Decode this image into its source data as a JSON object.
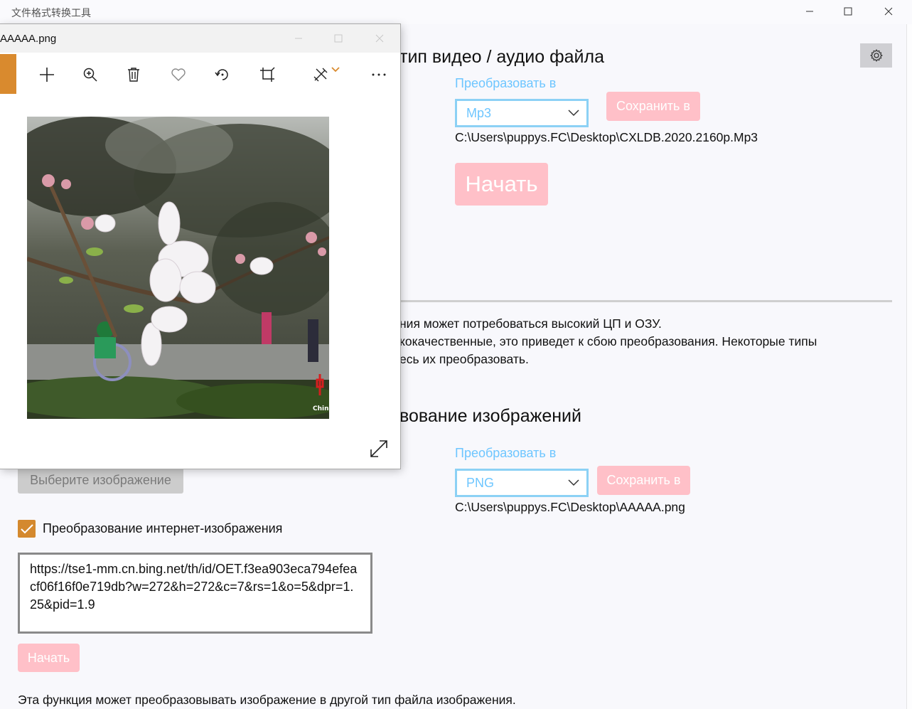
{
  "app": {
    "title": "文件格式转换工具"
  },
  "window_controls": {
    "minimize": "—",
    "maximize": "□",
    "close": "✕"
  },
  "video_section": {
    "title": "тип видео / аудио файла",
    "convert_to_label": "Преобразовать в",
    "format_value": "Mp3",
    "save_button": "Сохранить в",
    "output_path": "C:\\Users\\puppys.FC\\Desktop\\CXLDB.2020.2160p.Mp3",
    "start_button": "Начать"
  },
  "notes": {
    "line1": "ния может потребоваться высокий ЦП и ОЗУ.",
    "line2": "кокачественные, это приведет к сбою преобразования. Некоторые типы",
    "line3": "есь их преобразовать."
  },
  "image_section": {
    "title": "вование изображений",
    "convert_to_label": "Преобразовать в",
    "format_value": "PNG",
    "save_button": "Сохранить в",
    "output_path": "C:\\Users\\puppys.FC\\Desktop\\AAAAA.png",
    "select_image_button": "Выберите изображение",
    "internet_checkbox_label": "Преобразование интернет-изображения",
    "internet_checkbox_checked": true,
    "url_value": "https://tse1-mm.cn.bing.net/th/id/OET.f3ea903eca794efeacf06f16f0e719db?w=272&h=272&c=7&rs=1&o=5&dpr=1.25&pid=1.9",
    "start_button": "Начать",
    "description": "Эта функция может преобразовывать изображение в другой тип файла изображения."
  },
  "photo_viewer": {
    "title": "AAAAA.png",
    "toolbar_icons": [
      "add-icon",
      "zoom-icon",
      "delete-icon",
      "favorite-icon",
      "rotate-icon",
      "crop-icon",
      "edit-icon",
      "more-icon"
    ],
    "photo_watermark": "Chin"
  },
  "colors": {
    "accent_pink": "#ffc0c8",
    "accent_blue": "#6ec6ff",
    "checkbox_orange": "#d4892e"
  }
}
